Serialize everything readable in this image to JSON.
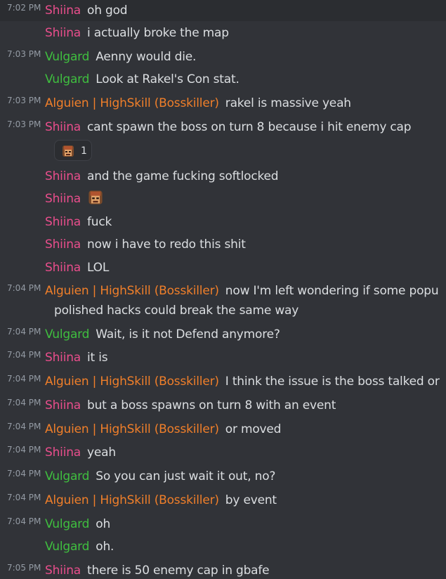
{
  "colors": {
    "background": "#313338",
    "hover_row": "#2b2d31",
    "timestamp": "#949ba4",
    "text": "#dbdee1",
    "author_shiina": "#e94e8c",
    "author_vulgard": "#3fbf3f",
    "author_alguien": "#f07f2a"
  },
  "messages": [
    {
      "time": "7:02 PM",
      "author": "Shiina",
      "text": "oh god"
    },
    {
      "time": "",
      "author": "Shiina",
      "text": "i actually broke the map"
    },
    {
      "time": "7:03 PM",
      "author": "Vulgard",
      "text": "Aenny would die."
    },
    {
      "time": "",
      "author": "Vulgard",
      "text": "Look at Rakel's Con stat."
    },
    {
      "time": "7:03 PM",
      "author": "Alguien | HighSkill (Bosskiller)",
      "text": "rakel is massive yeah"
    },
    {
      "time": "7:03 PM",
      "author": "Shiina",
      "text": "cant spawn the boss on turn 8 because i hit enemy cap"
    },
    {
      "time": "",
      "author": "Shiina",
      "text": "and the game fucking softlocked"
    },
    {
      "time": "",
      "author": "Shiina",
      "text": "",
      "emoji": "face-emoji"
    },
    {
      "time": "",
      "author": "Shiina",
      "text": "fuck"
    },
    {
      "time": "",
      "author": "Shiina",
      "text": "now i have to redo this shit"
    },
    {
      "time": "",
      "author": "Shiina",
      "text": "LOL"
    },
    {
      "time": "7:04 PM",
      "author": "Alguien | HighSkill (Bosskiller)",
      "text": "now I'm left wondering if some popu",
      "text2": "polished hacks could break the same way"
    },
    {
      "time": "7:04 PM",
      "author": "Vulgard",
      "text": "Wait, is it not Defend anymore?"
    },
    {
      "time": "7:04 PM",
      "author": "Shiina",
      "text": "it is"
    },
    {
      "time": "7:04 PM",
      "author": "Alguien | HighSkill (Bosskiller)",
      "text": "I think the issue is the boss talked or"
    },
    {
      "time": "7:04 PM",
      "author": "Shiina",
      "text": "but a boss spawns on turn 8 with an event"
    },
    {
      "time": "7:04 PM",
      "author": "Alguien | HighSkill (Bosskiller)",
      "text": "or moved"
    },
    {
      "time": "7:04 PM",
      "author": "Shiina",
      "text": "yeah"
    },
    {
      "time": "7:04 PM",
      "author": "Vulgard",
      "text": "So you can just wait it out, no?"
    },
    {
      "time": "7:04 PM",
      "author": "Alguien | HighSkill (Bosskiller)",
      "text": "by event"
    },
    {
      "time": "7:04 PM",
      "author": "Vulgard",
      "text": "oh"
    },
    {
      "time": "",
      "author": "Vulgard",
      "text": "oh."
    },
    {
      "time": "7:05 PM",
      "author": "Shiina",
      "text": "there is 50 enemy cap in gbafe"
    }
  ],
  "reaction": {
    "emoji": "face-emoji",
    "count": "1"
  }
}
